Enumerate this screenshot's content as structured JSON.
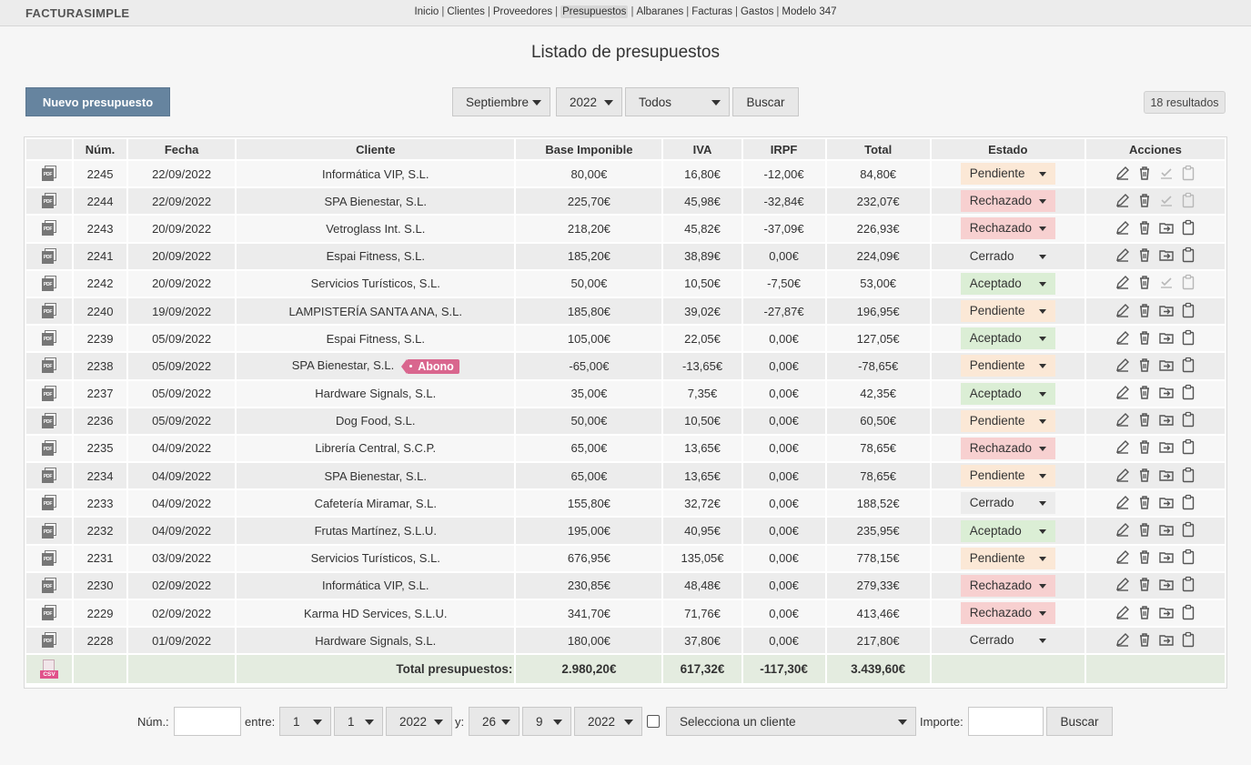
{
  "brand": "FACTURASIMPLE",
  "nav": [
    {
      "label": "Inicio",
      "active": false
    },
    {
      "label": "Clientes",
      "active": false
    },
    {
      "label": "Proveedores",
      "active": false
    },
    {
      "label": "Presupuestos",
      "active": true
    },
    {
      "label": "Albaranes",
      "active": false
    },
    {
      "label": "Facturas",
      "active": false
    },
    {
      "label": "Gastos",
      "active": false
    },
    {
      "label": "Modelo 347",
      "active": false
    }
  ],
  "nav_separator": "|",
  "page_title": "Listado de presupuestos",
  "toolbar": {
    "new_button": "Nuevo presupuesto",
    "month": "Septiembre",
    "year": "2022",
    "status_filter": "Todos",
    "search_button": "Buscar",
    "results": "18 resultados"
  },
  "table": {
    "headers": [
      "",
      "Núm.",
      "Fecha",
      "Cliente",
      "Base Imponible",
      "IVA",
      "IRPF",
      "Total",
      "Estado",
      "Acciones"
    ],
    "pdf_icon_text": "PDF",
    "rows": [
      {
        "num": "2245",
        "fecha": "22/09/2022",
        "cliente": "Informática VIP, S.L.",
        "base": "80,00€",
        "iva": "16,80€",
        "irpf": "-12,00€",
        "total": "84,80€",
        "estado": "Pendiente",
        "tag": "",
        "last_icons_muted": true
      },
      {
        "num": "2244",
        "fecha": "22/09/2022",
        "cliente": "SPA Bienestar, S.L.",
        "base": "225,70€",
        "iva": "45,98€",
        "irpf": "-32,84€",
        "total": "232,07€",
        "estado": "Rechazado",
        "tag": "",
        "last_icons_muted": true
      },
      {
        "num": "2243",
        "fecha": "20/09/2022",
        "cliente": "Vetroglass Int. S.L.",
        "base": "218,20€",
        "iva": "45,82€",
        "irpf": "-37,09€",
        "total": "226,93€",
        "estado": "Rechazado",
        "tag": "",
        "last_icons_muted": false
      },
      {
        "num": "2241",
        "fecha": "20/09/2022",
        "cliente": "Espai Fitness, S.L.",
        "base": "185,20€",
        "iva": "38,89€",
        "irpf": "0,00€",
        "total": "224,09€",
        "estado": "Cerrado",
        "tag": "",
        "last_icons_muted": false
      },
      {
        "num": "2242",
        "fecha": "20/09/2022",
        "cliente": "Servicios Turísticos, S.L.",
        "base": "50,00€",
        "iva": "10,50€",
        "irpf": "-7,50€",
        "total": "53,00€",
        "estado": "Aceptado",
        "tag": "",
        "last_icons_muted": true
      },
      {
        "num": "2240",
        "fecha": "19/09/2022",
        "cliente": "LAMPISTERÍA SANTA ANA, S.L.",
        "base": "185,80€",
        "iva": "39,02€",
        "irpf": "-27,87€",
        "total": "196,95€",
        "estado": "Pendiente",
        "tag": "",
        "last_icons_muted": false
      },
      {
        "num": "2239",
        "fecha": "05/09/2022",
        "cliente": "Espai Fitness, S.L.",
        "base": "105,00€",
        "iva": "22,05€",
        "irpf": "0,00€",
        "total": "127,05€",
        "estado": "Aceptado",
        "tag": "",
        "last_icons_muted": false
      },
      {
        "num": "2238",
        "fecha": "05/09/2022",
        "cliente": "SPA Bienestar, S.L.",
        "base": "-65,00€",
        "iva": "-13,65€",
        "irpf": "0,00€",
        "total": "-78,65€",
        "estado": "Pendiente",
        "tag": "Abono",
        "last_icons_muted": false
      },
      {
        "num": "2237",
        "fecha": "05/09/2022",
        "cliente": "Hardware Signals, S.L.",
        "base": "35,00€",
        "iva": "7,35€",
        "irpf": "0,00€",
        "total": "42,35€",
        "estado": "Aceptado",
        "tag": "",
        "last_icons_muted": false
      },
      {
        "num": "2236",
        "fecha": "05/09/2022",
        "cliente": "Dog Food, S.L.",
        "base": "50,00€",
        "iva": "10,50€",
        "irpf": "0,00€",
        "total": "60,50€",
        "estado": "Pendiente",
        "tag": "",
        "last_icons_muted": false
      },
      {
        "num": "2235",
        "fecha": "04/09/2022",
        "cliente": "Librería Central, S.C.P.",
        "base": "65,00€",
        "iva": "13,65€",
        "irpf": "0,00€",
        "total": "78,65€",
        "estado": "Rechazado",
        "tag": "",
        "last_icons_muted": false
      },
      {
        "num": "2234",
        "fecha": "04/09/2022",
        "cliente": "SPA Bienestar, S.L.",
        "base": "65,00€",
        "iva": "13,65€",
        "irpf": "0,00€",
        "total": "78,65€",
        "estado": "Pendiente",
        "tag": "",
        "last_icons_muted": false
      },
      {
        "num": "2233",
        "fecha": "04/09/2022",
        "cliente": "Cafetería Miramar, S.L.",
        "base": "155,80€",
        "iva": "32,72€",
        "irpf": "0,00€",
        "total": "188,52€",
        "estado": "Cerrado",
        "tag": "",
        "last_icons_muted": false
      },
      {
        "num": "2232",
        "fecha": "04/09/2022",
        "cliente": "Frutas Martínez, S.L.U.",
        "base": "195,00€",
        "iva": "40,95€",
        "irpf": "0,00€",
        "total": "235,95€",
        "estado": "Aceptado",
        "tag": "",
        "last_icons_muted": false
      },
      {
        "num": "2231",
        "fecha": "03/09/2022",
        "cliente": "Servicios Turísticos, S.L.",
        "base": "676,95€",
        "iva": "135,05€",
        "irpf": "0,00€",
        "total": "778,15€",
        "estado": "Pendiente",
        "tag": "",
        "last_icons_muted": false
      },
      {
        "num": "2230",
        "fecha": "02/09/2022",
        "cliente": "Informática VIP, S.L.",
        "base": "230,85€",
        "iva": "48,48€",
        "irpf": "0,00€",
        "total": "279,33€",
        "estado": "Rechazado",
        "tag": "",
        "last_icons_muted": false
      },
      {
        "num": "2229",
        "fecha": "02/09/2022",
        "cliente": "Karma HD Services, S.L.U.",
        "base": "341,70€",
        "iva": "71,76€",
        "irpf": "0,00€",
        "total": "413,46€",
        "estado": "Rechazado",
        "tag": "",
        "last_icons_muted": false
      },
      {
        "num": "2228",
        "fecha": "01/09/2022",
        "cliente": "Hardware Signals, S.L.",
        "base": "180,00€",
        "iva": "37,80€",
        "irpf": "0,00€",
        "total": "217,80€",
        "estado": "Cerrado",
        "tag": "",
        "last_icons_muted": false
      }
    ],
    "totals": {
      "csv_icon_text": "CSV",
      "label": "Total presupuestos:",
      "base": "2.980,20€",
      "iva": "617,32€",
      "irpf": "-117,30€",
      "total": "3.439,60€"
    }
  },
  "estado_colors": {
    "Pendiente": "#fbe8d6",
    "Rechazado": "#f7d0d0",
    "Cerrado": "#ececec",
    "Aceptado": "#dbeed5"
  },
  "action_icons": [
    "edit-icon",
    "trash-icon",
    "convert-icon",
    "clipboard-icon"
  ],
  "filters": {
    "num_label": "Núm.:",
    "num_value": "",
    "between_label": "entre:",
    "from_day": "1",
    "from_month": "1",
    "from_year": "2022",
    "and_label": "y:",
    "to_day": "26",
    "to_month": "9",
    "to_year": "2022",
    "client_select": "Selecciona un cliente",
    "amount_label": "Importe:",
    "amount_value": "",
    "search_button": "Buscar"
  },
  "colors": {
    "primary_button": "#66849f",
    "abono_tag": "#d9668e",
    "total_row": "#e4ece0"
  }
}
